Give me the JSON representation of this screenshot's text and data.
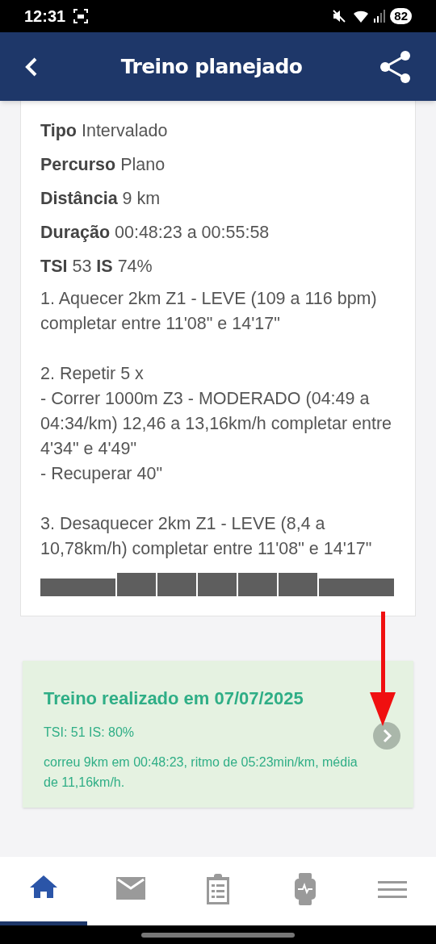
{
  "status_bar": {
    "time": "12:31",
    "battery": "82"
  },
  "header": {
    "title": "Treino planejado"
  },
  "summary": [
    "**Tipo** Intervalado",
    "**Percurso** Plano",
    "**Distância** 9 km",
    "**Duração** 00:48:23 a 00:55:58",
    "**TSI** 53 **IS** 74%"
  ],
  "steps": [
    {
      "lines": [
        "1. Aquecer 2km Z1 - LEVE (109 a 116 bpm) completar entre 11'08\" e 14'17\""
      ]
    },
    {
      "lines": [
        "2. Repetir 5 x",
        "- Correr 1000m Z3 - MODERADO (04:49 a 04:34/km) 12,46 a 13,16km/h completar entre 4'34\" e 4'49\"",
        "- Recuperar 40\""
      ]
    },
    {
      "lines": [
        "3. Desaquecer 2km Z1 - LEVE (8,4 a 10,78km/h) completar entre 11'08\" e 14'17\""
      ]
    }
  ],
  "intensity_bar": [
    {
      "kind": "easy"
    },
    {
      "kind": "hard"
    },
    {
      "kind": "hard"
    },
    {
      "kind": "hard"
    },
    {
      "kind": "hard"
    },
    {
      "kind": "hard"
    },
    {
      "kind": "easy"
    }
  ],
  "completed": {
    "title": "Treino realizado em 07/07/2025",
    "stats": "TSI: 51 IS: 80%",
    "description": "correu 9km em 00:48:23, ritmo de 05:23min/km, média de 11,16km/h."
  },
  "bottom_nav": [
    {
      "kind": "home",
      "selected": true
    },
    {
      "kind": "mail",
      "selected": false
    },
    {
      "kind": "clipboard",
      "selected": false
    },
    {
      "kind": "watch",
      "selected": false
    },
    {
      "kind": "menu",
      "selected": false
    }
  ]
}
